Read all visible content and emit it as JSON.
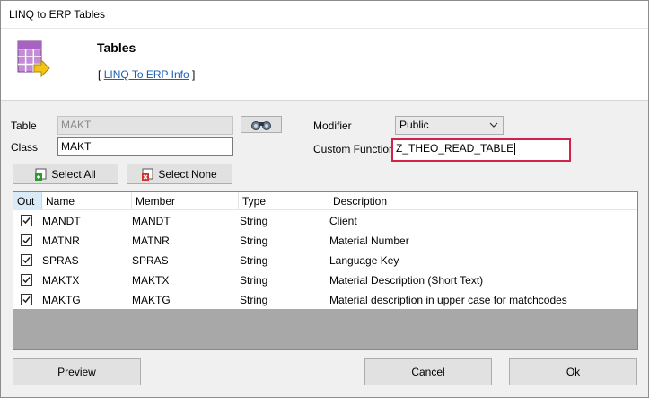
{
  "window": {
    "title": "LINQ to ERP Tables"
  },
  "header": {
    "title": "Tables",
    "link_prefix": "[",
    "link_text": "LINQ To ERP Info",
    "link_suffix": "]"
  },
  "form": {
    "table_label": "Table",
    "table_value": "MAKT",
    "class_label": "Class",
    "class_value": "MAKT",
    "modifier_label": "Modifier",
    "modifier_value": "Public",
    "custom_function_label": "Custom Function",
    "custom_function_value": "Z_THEO_READ_TABLE"
  },
  "actions": {
    "select_all": "Select All",
    "select_none": "Select None",
    "preview": "Preview",
    "cancel": "Cancel",
    "ok": "Ok"
  },
  "grid": {
    "columns": [
      "Out",
      "Name",
      "Member",
      "Type",
      "Description"
    ],
    "rows": [
      {
        "out": true,
        "name": "MANDT",
        "member": "MANDT",
        "type": "String",
        "description": "Client"
      },
      {
        "out": true,
        "name": "MATNR",
        "member": "MATNR",
        "type": "String",
        "description": "Material Number"
      },
      {
        "out": true,
        "name": "SPRAS",
        "member": "SPRAS",
        "type": "String",
        "description": "Language Key"
      },
      {
        "out": true,
        "name": "MAKTX",
        "member": "MAKTX",
        "type": "String",
        "description": "Material Description (Short Text)"
      },
      {
        "out": true,
        "name": "MAKTG",
        "member": "MAKTG",
        "type": "String",
        "description": "Material description in upper case for matchcodes"
      }
    ]
  },
  "icons": {
    "header": "table-icon",
    "lookup": "binoculars-icon",
    "select_all": "checkbox-add-icon",
    "select_none": "checkbox-remove-icon",
    "dropdown": "chevron-down-icon"
  },
  "colors": {
    "highlight": "#d1234a",
    "link": "#1a5fb4",
    "out_header": "#d9ebf9"
  }
}
